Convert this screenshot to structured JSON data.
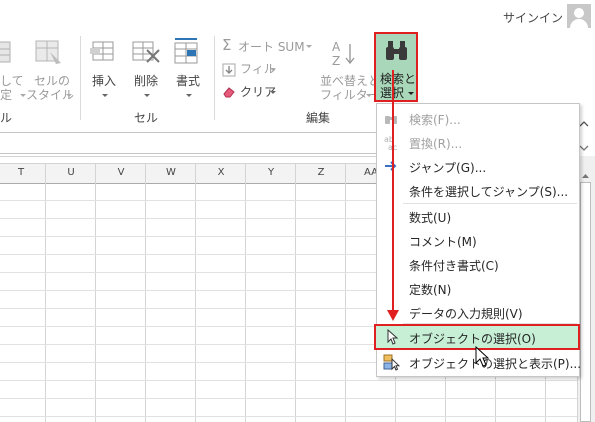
{
  "titlebar": {
    "signin": "サインイン"
  },
  "ribbon": {
    "cell_style": {
      "line1": "セルの",
      "line2": "スタイル"
    },
    "table_format": {
      "line1": "して",
      "line2": "定"
    },
    "cells_group": {
      "label": "セル",
      "insert": "挿入",
      "delete": "削除",
      "format": "書式"
    },
    "editing_group": {
      "label": "編集",
      "autosum": "オート SUM",
      "fill": "フィル",
      "clear": "クリア",
      "sort_line1": "並べ替えと",
      "sort_line2": "フィルター",
      "find_line1": "検索と",
      "find_line2": "選択"
    },
    "left_group_label": "ル"
  },
  "columns": [
    "T",
    "U",
    "V",
    "W",
    "X",
    "Y",
    "Z",
    "AA"
  ],
  "menu": {
    "items": [
      {
        "label": "検索(F)...",
        "icon": "binoculars-icon",
        "disabled": true
      },
      {
        "label": "置換(R)...",
        "icon": "replace-icon",
        "disabled": true
      },
      {
        "label": "ジャンプ(G)...",
        "icon": "arrow-right-icon",
        "disabled": false
      },
      {
        "label": "条件を選択してジャンプ(S)...",
        "icon": "",
        "disabled": false
      },
      {
        "label": "数式(U)",
        "icon": "",
        "disabled": false
      },
      {
        "label": "コメント(M)",
        "icon": "",
        "disabled": false
      },
      {
        "label": "条件付き書式(C)",
        "icon": "",
        "disabled": false
      },
      {
        "label": "定数(N)",
        "icon": "",
        "disabled": false
      },
      {
        "label": "データの入力規則(V)",
        "icon": "",
        "disabled": false
      },
      {
        "label": "オブジェクトの選択(O)",
        "icon": "pointer-icon",
        "disabled": false,
        "highlighted": true
      },
      {
        "label": "オブジェクトの選択と表示(P)...",
        "icon": "selection-pane-icon",
        "disabled": false
      }
    ]
  },
  "colors": {
    "highlight_border": "#e02020",
    "button_highlight": "#a8d8b9",
    "menu_hover": "#c6efd5"
  }
}
